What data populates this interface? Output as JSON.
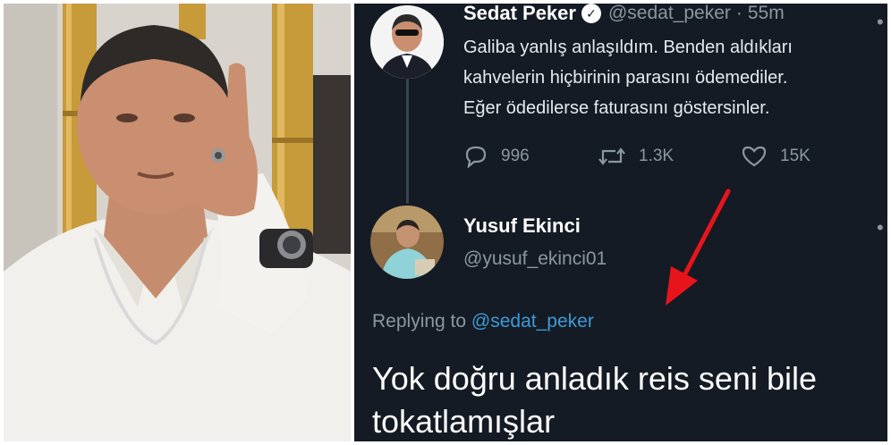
{
  "original_tweet": {
    "author_name": "Sedat Peker",
    "verified_glyph": "✓",
    "handle": "@sedat_peker",
    "separator": "·",
    "time": "55m",
    "text_lines": [
      "Galiba yanlış anlaşıldım. Benden aldıkları",
      "kahvelerin hiçbirinin parasını ödemediler.",
      "Eğer ödedilerse faturasını göstersinler."
    ],
    "actions": {
      "replies": "996",
      "retweets": "1.3K",
      "likes": "15K"
    },
    "icons": [
      "reply-icon",
      "retweet-icon",
      "like-icon"
    ]
  },
  "reply_tweet": {
    "author_name": "Yusuf Ekinci",
    "handle": "@yusuf_ekinci01",
    "replying_to_prefix": "Replying to",
    "replying_to_handle": "@sedat_peker",
    "text": "Yok doğru anladık reis seni bile tokatlamışlar"
  },
  "colors": {
    "panel_background": "#151b24",
    "mention_blue": "#3d9bd8",
    "muted_text": "#8a97a3",
    "annotation_arrow": "#e8141c"
  }
}
